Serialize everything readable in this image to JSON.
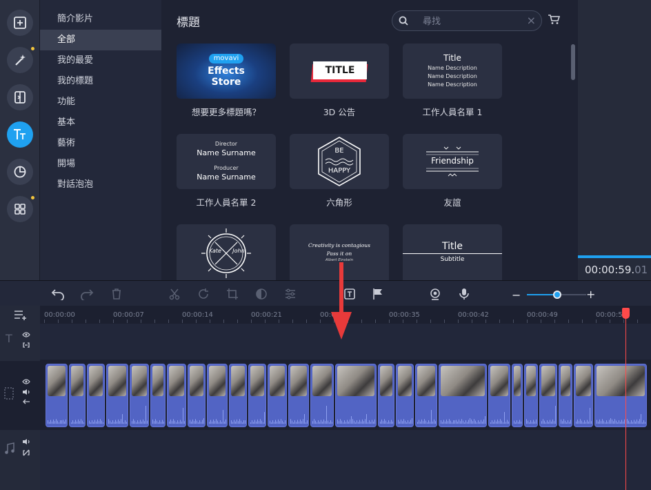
{
  "rail": {
    "items": [
      {
        "name": "import",
        "icon": "add-file-icon"
      },
      {
        "name": "filters",
        "icon": "magic-wand-icon"
      },
      {
        "name": "transitions",
        "icon": "transition-icon"
      },
      {
        "name": "titles",
        "icon": "titles-tt-icon",
        "active": true
      },
      {
        "name": "stickers",
        "icon": "sticker-icon"
      },
      {
        "name": "more-tools",
        "icon": "grid-icon"
      }
    ]
  },
  "categories": [
    {
      "label": "簡介影片"
    },
    {
      "label": "全部",
      "active": true
    },
    {
      "label": "我的最愛"
    },
    {
      "label": "我的標題"
    },
    {
      "label": "功能"
    },
    {
      "label": "基本"
    },
    {
      "label": "藝術"
    },
    {
      "label": "開場"
    },
    {
      "label": "對話泡泡"
    }
  ],
  "content": {
    "title": "標題",
    "search_placeholder": "尋找"
  },
  "tiles": {
    "store": {
      "brand": "movavi",
      "line1": "Effects",
      "line2": "Store",
      "label": "想要更多標題嗎？"
    },
    "billboard": {
      "text": "TITLE",
      "label": "3D 公告"
    },
    "credits1": {
      "title": "Title",
      "lines": [
        "Name Description",
        "Name Description",
        "Name Description"
      ],
      "label": "工作人員名單 1"
    },
    "credits2": {
      "role1": "Director",
      "name1": "Name Surname",
      "role2": "Producer",
      "name2": "Name Surname",
      "label": "工作人員名單 2"
    },
    "hexagon": {
      "line1": "BE",
      "line2": "HAPPY",
      "label": "六角形"
    },
    "friendship": {
      "text": "Friendship",
      "label": "友誼"
    },
    "badge": {
      "left": "Kate",
      "right": "John"
    },
    "quote": {
      "line1": "Creativity is contagious",
      "line2": "Pass it on",
      "author": "Albert Einstein"
    },
    "subtitle": {
      "title": "Title",
      "subtitle": "Subtitle"
    }
  },
  "preview": {
    "time_main": "00:00:59.",
    "time_ms": "01"
  },
  "ruler": {
    "labels": [
      "00:00:00",
      "00:00:07",
      "00:00:14",
      "00:00:21",
      "00:00:28",
      "00:00:35",
      "00:00:42",
      "00:00:49",
      "00:00:56"
    ]
  },
  "colors": {
    "accent": "#1fa1f0",
    "clip": "#5264c4",
    "playhead": "#ff4a4a",
    "annotation_arrow": "#e83a3a"
  }
}
